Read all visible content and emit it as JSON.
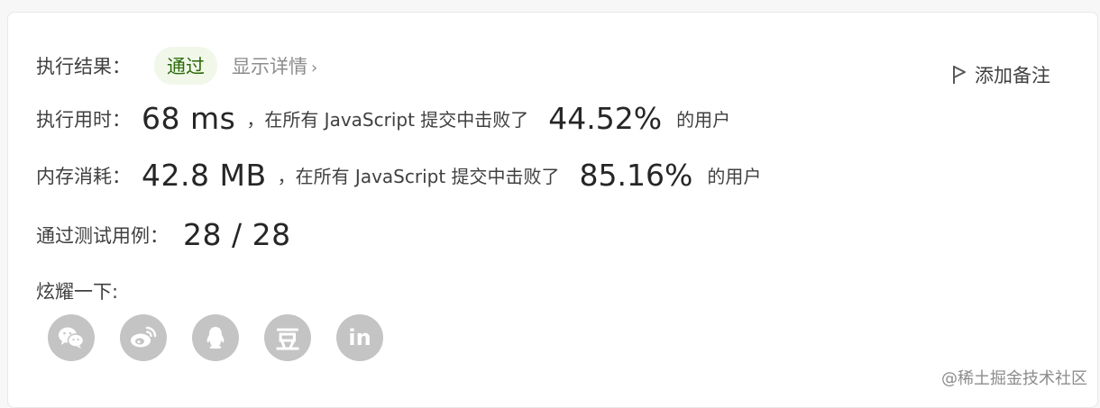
{
  "result": {
    "label": "执行结果：",
    "status": "通过",
    "details_link": "显示详情",
    "chevron": "›"
  },
  "note_button": {
    "label": "添加备注",
    "icon": "flag-icon"
  },
  "runtime": {
    "label": "执行用时：",
    "value": "68 ms",
    "text_before": "，在所有 JavaScript 提交中击败了",
    "percent": "44.52%",
    "text_after": "的用户"
  },
  "memory": {
    "label": "内存消耗：",
    "value": "42.8 MB",
    "text_before": "，在所有 JavaScript 提交中击败了",
    "percent": "85.16%",
    "text_after": "的用户"
  },
  "tests": {
    "label": "通过测试用例：",
    "value": "28 / 28"
  },
  "share": {
    "label": "炫耀一下:",
    "items": [
      {
        "name": "wechat",
        "icon": "wechat-icon"
      },
      {
        "name": "weibo",
        "icon": "weibo-icon"
      },
      {
        "name": "qq",
        "icon": "qq-icon"
      },
      {
        "name": "douban",
        "icon": "douban-icon",
        "glyph": "豆"
      },
      {
        "name": "linkedin",
        "icon": "linkedin-icon",
        "glyph": "in"
      }
    ]
  },
  "watermark": "@稀土掘金技术社区",
  "colors": {
    "pass_text": "#2d6a0a",
    "pass_bg": "#f1f8ea",
    "social_icon_bg": "#c4c4c4"
  }
}
